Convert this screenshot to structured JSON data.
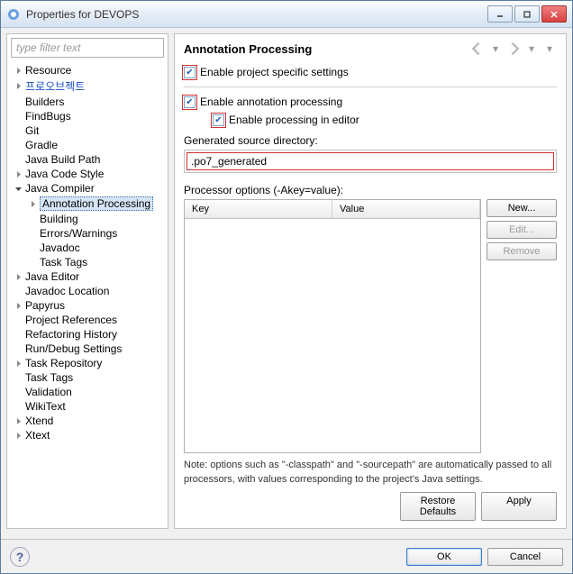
{
  "window": {
    "title": "Properties for DEVOPS"
  },
  "sidebar": {
    "filter_placeholder": "type filter text",
    "items": [
      {
        "label": "Resource",
        "level": 1,
        "arrow": "right"
      },
      {
        "label": "프로오브젝트",
        "level": 1,
        "arrow": "right",
        "highlight": true
      },
      {
        "label": "Builders",
        "level": 1,
        "arrow": ""
      },
      {
        "label": "FindBugs",
        "level": 1,
        "arrow": ""
      },
      {
        "label": "Git",
        "level": 1,
        "arrow": ""
      },
      {
        "label": "Gradle",
        "level": 1,
        "arrow": ""
      },
      {
        "label": "Java Build Path",
        "level": 1,
        "arrow": ""
      },
      {
        "label": "Java Code Style",
        "level": 1,
        "arrow": "right"
      },
      {
        "label": "Java Compiler",
        "level": 1,
        "arrow": "down"
      },
      {
        "label": "Annotation Processing",
        "level": 2,
        "arrow": "right",
        "selected": true
      },
      {
        "label": "Building",
        "level": 2,
        "arrow": ""
      },
      {
        "label": "Errors/Warnings",
        "level": 2,
        "arrow": ""
      },
      {
        "label": "Javadoc",
        "level": 2,
        "arrow": ""
      },
      {
        "label": "Task Tags",
        "level": 2,
        "arrow": ""
      },
      {
        "label": "Java Editor",
        "level": 1,
        "arrow": "right"
      },
      {
        "label": "Javadoc Location",
        "level": 1,
        "arrow": ""
      },
      {
        "label": "Papyrus",
        "level": 1,
        "arrow": "right"
      },
      {
        "label": "Project References",
        "level": 1,
        "arrow": ""
      },
      {
        "label": "Refactoring History",
        "level": 1,
        "arrow": ""
      },
      {
        "label": "Run/Debug Settings",
        "level": 1,
        "arrow": ""
      },
      {
        "label": "Task Repository",
        "level": 1,
        "arrow": "right"
      },
      {
        "label": "Task Tags",
        "level": 1,
        "arrow": ""
      },
      {
        "label": "Validation",
        "level": 1,
        "arrow": ""
      },
      {
        "label": "WikiText",
        "level": 1,
        "arrow": ""
      },
      {
        "label": "Xtend",
        "level": 1,
        "arrow": "right"
      },
      {
        "label": "Xtext",
        "level": 1,
        "arrow": "right"
      }
    ]
  },
  "main": {
    "title": "Annotation Processing",
    "enable_project": "Enable project specific settings",
    "enable_annotation": "Enable annotation processing",
    "enable_editor": "Enable processing in editor",
    "gen_dir_label": "Generated source directory:",
    "gen_dir_value": ".po7_generated",
    "proc_opts_label": "Processor options (-Akey=value):",
    "table": {
      "col_key": "Key",
      "col_value": "Value"
    },
    "buttons": {
      "new": "New...",
      "edit": "Edit...",
      "remove": "Remove"
    },
    "note": "Note: options such as \"-classpath\" and \"-sourcepath\" are automatically passed to all processors, with values corresponding to the project's Java settings.",
    "restore": "Restore Defaults",
    "apply": "Apply"
  },
  "footer": {
    "ok": "OK",
    "cancel": "Cancel"
  }
}
